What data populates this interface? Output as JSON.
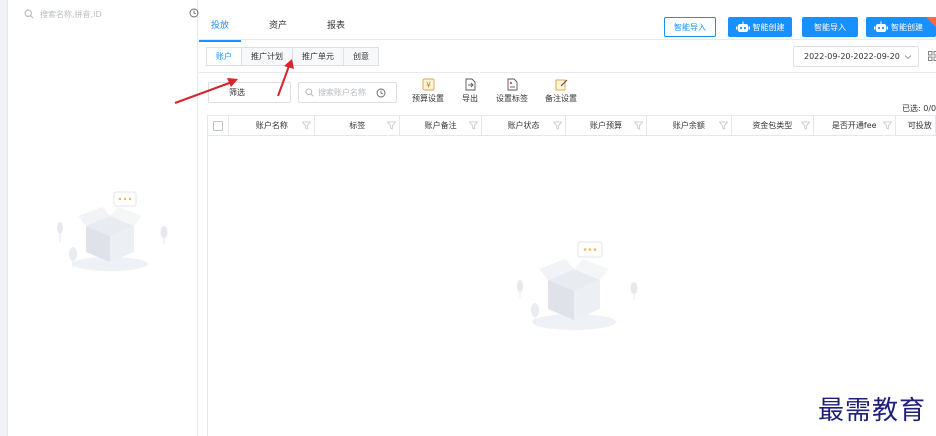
{
  "sidebar": {
    "search_placeholder": "搜索名称,拼音,ID",
    "icons": {
      "search": "search-icon",
      "history": "clock-icon",
      "empty": "empty-box-illustration"
    }
  },
  "top_tabs": [
    {
      "label": "投放",
      "active": true
    },
    {
      "label": "资产",
      "active": false
    },
    {
      "label": "报表",
      "active": false
    }
  ],
  "action_buttons": [
    {
      "label": "智能导入",
      "style": "outline"
    },
    {
      "label": "智能创建",
      "style": "solid",
      "icon": "robot-icon"
    },
    {
      "label": "智能导入",
      "style": "solid"
    },
    {
      "label": "智能创建",
      "style": "solid",
      "icon": "robot-icon"
    }
  ],
  "sub_tabs": [
    {
      "label": "账户",
      "active": true
    },
    {
      "label": "推广计划",
      "active": false
    },
    {
      "label": "推广单元",
      "active": false
    },
    {
      "label": "创意",
      "active": false
    }
  ],
  "date_range": "2022-09-20-2022-09-20",
  "toolbar": {
    "filter_label": "筛选",
    "search_placeholder": "搜索账户名称",
    "tools": [
      {
        "label": "预算设置",
        "icon": "budget-icon"
      },
      {
        "label": "导出",
        "icon": "export-icon"
      },
      {
        "label": "设置标签",
        "icon": "tag-icon"
      },
      {
        "label": "备注设置",
        "icon": "edit-icon"
      }
    ],
    "selected_count": "已选: 0/0"
  },
  "table": {
    "columns": [
      "账户名称",
      "标签",
      "账户备注",
      "账户状态",
      "账户预算",
      "账户余额",
      "资金包类型",
      "是否开通fee",
      "可投放"
    ]
  },
  "watermark": "最需教育",
  "colors": {
    "accent": "#1890ff",
    "arrow": "#d9232d",
    "watermark": "#1f1f7a"
  }
}
